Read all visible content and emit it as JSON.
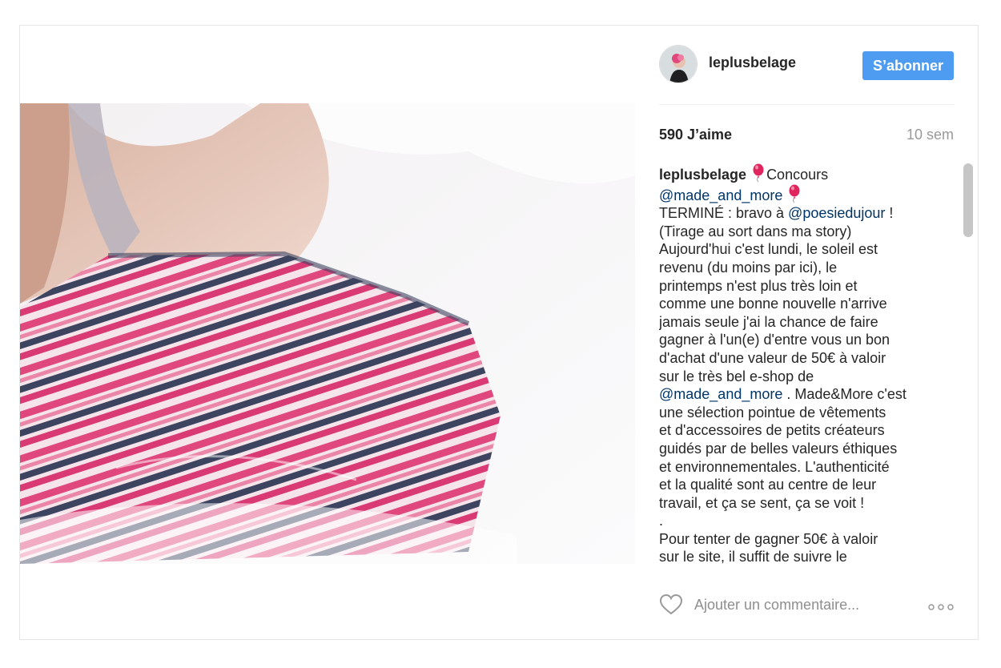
{
  "post": {
    "username": "leplusbelage",
    "follow_label": "S’abonner",
    "likes": "590 J’aime",
    "time": "10 sem",
    "caption": {
      "l1_user": "leplusbelage",
      "l1_text": "Concours",
      "l2_mention": "@made_and_more",
      "l3_pre": "TERMINÉ : bravo à ",
      "l3_mention": "@poesiedujour",
      "l3_post": " !",
      "l4": "(Tirage au sort dans ma story)",
      "l5": "Aujourd'hui c'est lundi, le soleil est",
      "l6": "revenu (du moins par ici), le",
      "l7": "printemps n'est plus très loin et",
      "l8": "comme une bonne nouvelle n'arrive",
      "l9": "jamais seule j'ai la chance de faire",
      "l10": "gagner à l'un(e) d'entre vous un bon",
      "l11": "d'achat d'une valeur de 50€ à valoir",
      "l12": "sur le très bel e-shop de",
      "l13_mention": "@made_and_more",
      "l13_post": " . Made&More c'est",
      "l14": "une sélection pointue de vêtements",
      "l15": "et d'accessoires de petits créateurs",
      "l16": "guidés par de belles valeurs éthiques",
      "l17": "et environnementales. L'authenticité",
      "l18": "et la qualité sont au centre de leur",
      "l19": "travail, et ça se sent, ça se voit !",
      "l20": ".",
      "l21": "Pour tenter de gagner 50€ à valoir",
      "l22": "sur le site, il suffit de suivre le"
    },
    "comment_placeholder": "Ajouter un commentaire...",
    "icons": {
      "like": "heart-outline-icon",
      "more": "more-options-icon",
      "emoji": "balloon-emoji"
    },
    "colors": {
      "follow_button": "#4d9cf1",
      "mention": "#003569",
      "balloon": "#e0245e"
    }
  }
}
